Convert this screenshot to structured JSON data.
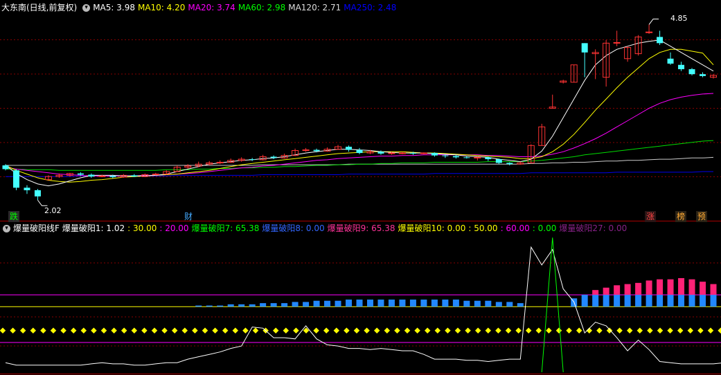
{
  "main_header": {
    "stock_title": "大东南(日线,前复权)",
    "ma_items": [
      {
        "label": "MA5: 3.98",
        "color": "#ffffff"
      },
      {
        "label": "MA10: 4.20",
        "color": "#ffff00"
      },
      {
        "label": "MA20: 3.74",
        "color": "#ff00ff"
      },
      {
        "label": "MA60: 2.98",
        "color": "#00ff00"
      },
      {
        "label": "MA120: 2.71",
        "color": "#dddddd"
      },
      {
        "label": "MA250: 2.48",
        "color": "#0000ff"
      }
    ]
  },
  "price_labels": {
    "high": "4.85",
    "low": "2.02"
  },
  "event_tags": {
    "die": "跌",
    "cai": "财",
    "zhang": "涨",
    "bang": "榜",
    "yu": "预"
  },
  "indicator_header": {
    "name": "爆量破阳线F",
    "items": [
      {
        "label": "爆量破阳1: 1.02",
        "color": "#ffffff"
      },
      {
        "label": ": 30.00",
        "color": "#ffff00"
      },
      {
        "label": ": 20.00",
        "color": "#ff00ff"
      },
      {
        "label": "爆量破阳7: 65.38",
        "color": "#00ff00"
      },
      {
        "label": "爆量破阳8: 0.00",
        "color": "#3366ff"
      },
      {
        "label": "爆量破阳9: 65.38",
        "color": "#ff3399"
      },
      {
        "label": "爆量破阳10: 0.00",
        "color": "#ffff00"
      },
      {
        "label": ": 50.00",
        "color": "#ffff00"
      },
      {
        "label": ": 60.00",
        "color": "#ff00ff"
      },
      {
        "label": ": 0.00",
        "color": "#00ff00"
      },
      {
        "label": "爆量破阳27: 0.00",
        "color": "#882288"
      }
    ]
  },
  "colors": {
    "up": "#ff3333",
    "down": "#44ffff",
    "ma5": "#ffffff",
    "ma10": "#ffff00",
    "ma20": "#ff00ff",
    "ma60": "#00dd00",
    "ma120": "#cccccc",
    "ma250": "#0000ee",
    "grid": "#880000",
    "blue_bar": "#2288ff",
    "pink_bar": "#ff2277"
  },
  "chart_data": {
    "type": "candlestick",
    "candles": [
      [
        2.58,
        2.52,
        2.6,
        2.5
      ],
      [
        2.5,
        2.22,
        2.52,
        2.18
      ],
      [
        2.22,
        2.18,
        2.26,
        2.12
      ],
      [
        2.18,
        2.08,
        2.2,
        2.02
      ],
      [
        2.35,
        2.4,
        2.42,
        2.33
      ],
      [
        2.4,
        2.42,
        2.45,
        2.38
      ],
      [
        2.42,
        2.45,
        2.46,
        2.4
      ],
      [
        2.45,
        2.43,
        2.47,
        2.41
      ],
      [
        2.43,
        2.4,
        2.45,
        2.38
      ],
      [
        2.4,
        2.41,
        2.43,
        2.39
      ],
      [
        2.41,
        2.39,
        2.43,
        2.37
      ],
      [
        2.39,
        2.42,
        2.44,
        2.38
      ],
      [
        2.42,
        2.4,
        2.44,
        2.39
      ],
      [
        2.4,
        2.43,
        2.45,
        2.39
      ],
      [
        2.43,
        2.44,
        2.46,
        2.42
      ],
      [
        2.44,
        2.48,
        2.5,
        2.43
      ],
      [
        2.48,
        2.55,
        2.58,
        2.47
      ],
      [
        2.55,
        2.57,
        2.6,
        2.53
      ],
      [
        2.57,
        2.6,
        2.64,
        2.55
      ],
      [
        2.6,
        2.62,
        2.65,
        2.58
      ],
      [
        2.62,
        2.63,
        2.66,
        2.6
      ],
      [
        2.63,
        2.66,
        2.69,
        2.62
      ],
      [
        2.66,
        2.68,
        2.71,
        2.64
      ],
      [
        2.68,
        2.67,
        2.7,
        2.65
      ],
      [
        2.67,
        2.72,
        2.75,
        2.66
      ],
      [
        2.72,
        2.7,
        2.74,
        2.68
      ],
      [
        2.7,
        2.74,
        2.77,
        2.69
      ],
      [
        2.74,
        2.82,
        2.85,
        2.73
      ],
      [
        2.82,
        2.83,
        2.86,
        2.8
      ],
      [
        2.83,
        2.81,
        2.85,
        2.79
      ],
      [
        2.81,
        2.84,
        2.87,
        2.8
      ],
      [
        2.84,
        2.88,
        2.91,
        2.83
      ],
      [
        2.88,
        2.83,
        2.9,
        2.8
      ],
      [
        2.83,
        2.78,
        2.86,
        2.76
      ],
      [
        2.78,
        2.8,
        2.83,
        2.76
      ],
      [
        2.8,
        2.77,
        2.82,
        2.75
      ],
      [
        2.77,
        2.78,
        2.8,
        2.75
      ],
      [
        2.78,
        2.78,
        2.8,
        2.76
      ],
      [
        2.78,
        2.77,
        2.8,
        2.75
      ],
      [
        2.77,
        2.78,
        2.79,
        2.76
      ],
      [
        2.78,
        2.74,
        2.79,
        2.72
      ],
      [
        2.74,
        2.73,
        2.76,
        2.7
      ],
      [
        2.73,
        2.71,
        2.75,
        2.69
      ],
      [
        2.71,
        2.7,
        2.73,
        2.69
      ],
      [
        2.7,
        2.71,
        2.72,
        2.66
      ],
      [
        2.71,
        2.68,
        2.72,
        2.65
      ],
      [
        2.68,
        2.62,
        2.69,
        2.6
      ],
      [
        2.62,
        2.6,
        2.63,
        2.58
      ],
      [
        2.6,
        2.62,
        2.64,
        2.59
      ],
      [
        2.62,
        2.9,
        2.92,
        2.62
      ],
      [
        2.9,
        3.2,
        3.25,
        2.9
      ],
      [
        3.5,
        3.52,
        3.72,
        3.5
      ],
      [
        3.92,
        3.94,
        3.96,
        3.9
      ],
      [
        3.92,
        4.2,
        4.2,
        3.92
      ],
      [
        4.55,
        4.4,
        4.55,
        4.0
      ],
      [
        4.38,
        4.4,
        4.45,
        3.97
      ],
      [
        4.0,
        4.55,
        4.6,
        3.85
      ],
      [
        4.55,
        4.56,
        4.75,
        4.5
      ],
      [
        4.3,
        4.48,
        4.5,
        4.25
      ],
      [
        4.38,
        4.65,
        4.68,
        4.35
      ],
      [
        4.72,
        4.73,
        4.85,
        4.7
      ],
      [
        4.65,
        4.55,
        4.75,
        4.52
      ],
      [
        4.3,
        4.22,
        4.4,
        4.2
      ],
      [
        4.2,
        4.13,
        4.25,
        4.1
      ],
      [
        4.13,
        4.05,
        4.15,
        4.03
      ],
      [
        4.05,
        4.02,
        4.08,
        4.0
      ],
      [
        4.0,
        4.03,
        4.05,
        3.98
      ]
    ],
    "ma5": [
      2.58,
      2.45,
      2.35,
      2.28,
      2.25,
      2.28,
      2.33,
      2.38,
      2.42,
      2.42,
      2.42,
      2.41,
      2.41,
      2.41,
      2.42,
      2.44,
      2.48,
      2.52,
      2.56,
      2.6,
      2.62,
      2.64,
      2.66,
      2.67,
      2.69,
      2.7,
      2.72,
      2.75,
      2.78,
      2.8,
      2.82,
      2.84,
      2.84,
      2.83,
      2.82,
      2.8,
      2.79,
      2.78,
      2.78,
      2.78,
      2.77,
      2.76,
      2.75,
      2.73,
      2.72,
      2.71,
      2.68,
      2.66,
      2.64,
      2.68,
      2.81,
      3.05,
      3.35,
      3.65,
      3.95,
      4.2,
      4.35,
      4.45,
      4.5,
      4.55,
      4.58,
      4.6,
      4.5,
      4.4,
      4.3,
      4.2,
      4.1
    ],
    "ma10": [
      2.58,
      2.5,
      2.44,
      2.38,
      2.34,
      2.32,
      2.31,
      2.32,
      2.34,
      2.35,
      2.37,
      2.39,
      2.4,
      2.41,
      2.42,
      2.43,
      2.44,
      2.46,
      2.48,
      2.5,
      2.53,
      2.56,
      2.59,
      2.61,
      2.63,
      2.65,
      2.67,
      2.69,
      2.71,
      2.73,
      2.75,
      2.77,
      2.78,
      2.79,
      2.8,
      2.8,
      2.8,
      2.8,
      2.79,
      2.78,
      2.78,
      2.77,
      2.76,
      2.75,
      2.74,
      2.73,
      2.72,
      2.71,
      2.69,
      2.69,
      2.72,
      2.8,
      2.92,
      3.08,
      3.27,
      3.47,
      3.65,
      3.83,
      4.0,
      4.15,
      4.3,
      4.4,
      4.45,
      4.45,
      4.42,
      4.39,
      4.2
    ],
    "ma20": [
      2.55,
      2.52,
      2.5,
      2.48,
      2.46,
      2.44,
      2.43,
      2.42,
      2.41,
      2.41,
      2.41,
      2.41,
      2.41,
      2.42,
      2.42,
      2.43,
      2.44,
      2.45,
      2.46,
      2.48,
      2.5,
      2.52,
      2.54,
      2.55,
      2.57,
      2.58,
      2.6,
      2.62,
      2.64,
      2.66,
      2.67,
      2.69,
      2.7,
      2.71,
      2.72,
      2.73,
      2.73,
      2.74,
      2.74,
      2.75,
      2.75,
      2.75,
      2.75,
      2.75,
      2.75,
      2.74,
      2.74,
      2.73,
      2.72,
      2.72,
      2.73,
      2.76,
      2.8,
      2.86,
      2.93,
      3.01,
      3.1,
      3.2,
      3.3,
      3.4,
      3.5,
      3.58,
      3.64,
      3.68,
      3.71,
      3.73,
      3.74
    ],
    "ma60": [
      2.52,
      2.52,
      2.51,
      2.51,
      2.51,
      2.5,
      2.5,
      2.5,
      2.5,
      2.5,
      2.5,
      2.5,
      2.5,
      2.5,
      2.5,
      2.51,
      2.51,
      2.51,
      2.52,
      2.52,
      2.53,
      2.53,
      2.54,
      2.54,
      2.55,
      2.55,
      2.56,
      2.56,
      2.57,
      2.58,
      2.58,
      2.59,
      2.59,
      2.6,
      2.6,
      2.61,
      2.61,
      2.62,
      2.62,
      2.62,
      2.63,
      2.63,
      2.63,
      2.63,
      2.63,
      2.64,
      2.64,
      2.64,
      2.64,
      2.65,
      2.66,
      2.68,
      2.7,
      2.72,
      2.75,
      2.77,
      2.79,
      2.81,
      2.83,
      2.85,
      2.87,
      2.89,
      2.91,
      2.93,
      2.95,
      2.97,
      2.98
    ],
    "ma120": [
      2.58,
      2.58,
      2.58,
      2.58,
      2.58,
      2.58,
      2.58,
      2.58,
      2.58,
      2.58,
      2.58,
      2.58,
      2.58,
      2.58,
      2.58,
      2.58,
      2.58,
      2.58,
      2.58,
      2.58,
      2.58,
      2.58,
      2.58,
      2.58,
      2.59,
      2.59,
      2.59,
      2.59,
      2.59,
      2.59,
      2.59,
      2.59,
      2.6,
      2.6,
      2.6,
      2.6,
      2.6,
      2.6,
      2.6,
      2.6,
      2.6,
      2.6,
      2.6,
      2.6,
      2.6,
      2.6,
      2.6,
      2.6,
      2.6,
      2.61,
      2.61,
      2.62,
      2.62,
      2.63,
      2.63,
      2.64,
      2.65,
      2.65,
      2.66,
      2.66,
      2.67,
      2.68,
      2.68,
      2.69,
      2.7,
      2.7,
      2.71
    ],
    "ma250": [
      2.4,
      2.4,
      2.4,
      2.4,
      2.4,
      2.4,
      2.4,
      2.41,
      2.41,
      2.41,
      2.41,
      2.41,
      2.41,
      2.41,
      2.41,
      2.41,
      2.42,
      2.42,
      2.42,
      2.42,
      2.42,
      2.42,
      2.42,
      2.42,
      2.43,
      2.43,
      2.43,
      2.43,
      2.43,
      2.43,
      2.43,
      2.43,
      2.44,
      2.44,
      2.44,
      2.44,
      2.44,
      2.44,
      2.44,
      2.44,
      2.45,
      2.45,
      2.45,
      2.45,
      2.45,
      2.45,
      2.45,
      2.45,
      2.45,
      2.46,
      2.46,
      2.46,
      2.46,
      2.46,
      2.46,
      2.46,
      2.46,
      2.47,
      2.47,
      2.47,
      2.47,
      2.47,
      2.47,
      2.47,
      2.47,
      2.48,
      2.48
    ],
    "price_range": [
      1.9,
      5.0
    ],
    "indicator": {
      "range": [
        -5,
        110
      ],
      "level_lines": [
        {
          "value": 60,
          "color": "#ff00ff"
        },
        {
          "value": 50,
          "color": "#ffff00"
        },
        {
          "value": 20,
          "color": "#ff00ff"
        }
      ],
      "dot_level": 30,
      "blue_bars": [
        0,
        0,
        0,
        0,
        0,
        0,
        0,
        0,
        0,
        0,
        0,
        0,
        0,
        0,
        0,
        0,
        0,
        0,
        51,
        51,
        51,
        52,
        52,
        52,
        53,
        53,
        53,
        54,
        54,
        55,
        55,
        55,
        56,
        56,
        56,
        56,
        56,
        56,
        56,
        56,
        56,
        56,
        56,
        55,
        55,
        55,
        54,
        54,
        53,
        0,
        0,
        0,
        0,
        57,
        60,
        60,
        60,
        60,
        60,
        60,
        60,
        60,
        60,
        60,
        60,
        60,
        60,
        60
      ],
      "pink_bars": [
        0,
        0,
        0,
        0,
        0,
        0,
        0,
        0,
        0,
        0,
        0,
        0,
        0,
        0,
        0,
        0,
        0,
        0,
        0,
        0,
        0,
        0,
        0,
        0,
        0,
        0,
        0,
        0,
        0,
        0,
        0,
        0,
        0,
        0,
        0,
        0,
        0,
        0,
        0,
        0,
        0,
        0,
        0,
        0,
        0,
        0,
        0,
        0,
        0,
        0,
        0,
        0,
        0,
        0,
        0,
        64,
        66,
        68,
        69,
        70,
        72,
        73,
        73,
        74,
        73,
        71,
        69,
        67,
        65
      ],
      "white_line": [
        3,
        1,
        1,
        1,
        1,
        1,
        1,
        1,
        2,
        3,
        2,
        2,
        1,
        1,
        2,
        3,
        3,
        6,
        8,
        10,
        12,
        15,
        17,
        33,
        32,
        24,
        24,
        23,
        34,
        23,
        18,
        17,
        15,
        15,
        14,
        15,
        14,
        13,
        13,
        10,
        6,
        6,
        6,
        5,
        5,
        4,
        5,
        6,
        6,
        100,
        85,
        98,
        65,
        54,
        28,
        37,
        34,
        24,
        13,
        22,
        14,
        4,
        3,
        2,
        2,
        2,
        2,
        3
      ],
      "green_line": [
        0,
        0,
        0,
        0,
        0,
        0,
        0,
        0,
        0,
        0,
        0,
        0,
        0,
        0,
        0,
        0,
        0,
        0,
        0,
        0,
        0,
        0,
        0,
        0,
        0,
        0,
        0,
        0,
        0,
        0,
        0,
        0,
        0,
        0,
        0,
        0,
        0,
        0,
        0,
        0,
        0,
        0,
        0,
        0,
        0,
        0,
        0,
        0,
        0,
        0,
        0,
        108,
        0,
        0,
        0,
        0,
        0,
        0,
        0,
        0,
        0,
        0,
        0,
        0,
        0,
        0,
        0,
        0
      ]
    }
  }
}
